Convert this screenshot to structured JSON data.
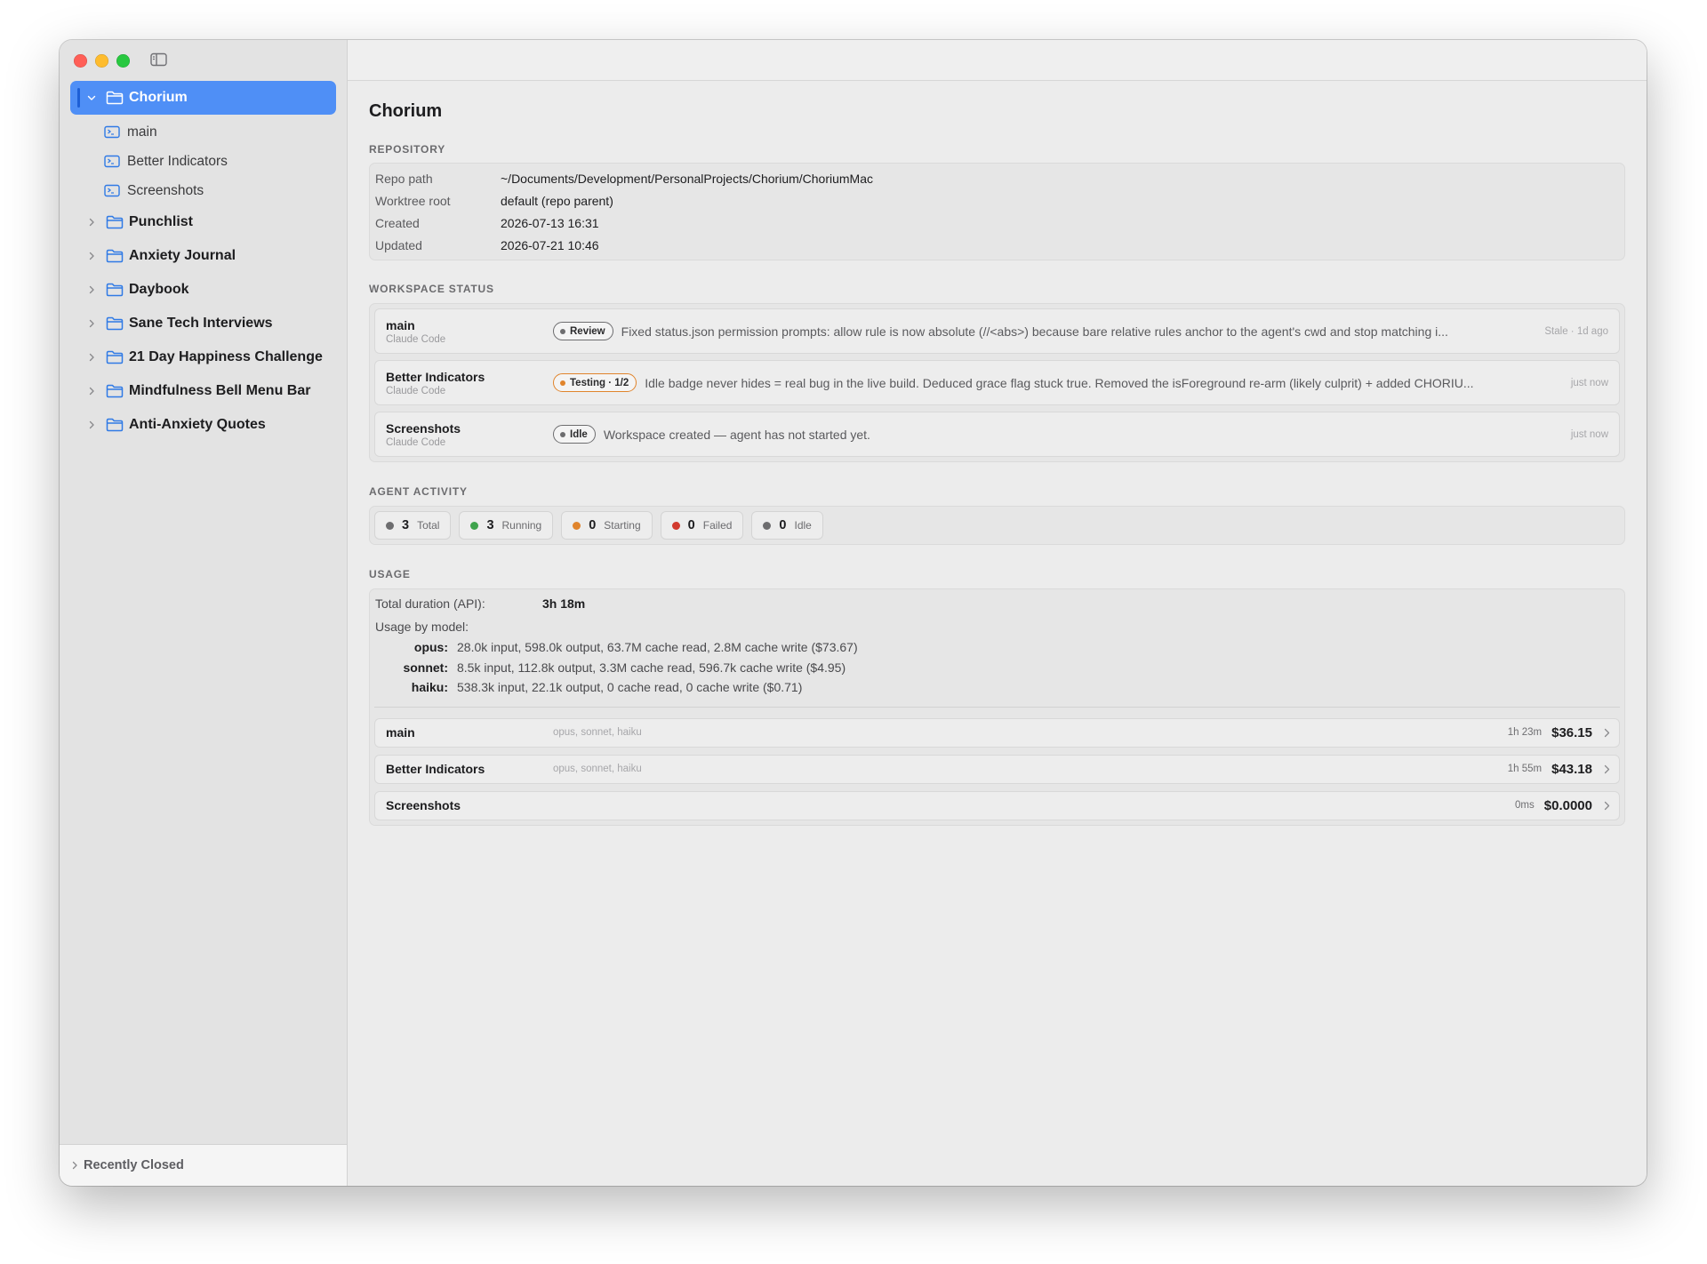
{
  "sidebar": {
    "projects": [
      {
        "label": "Chorium",
        "expanded": true,
        "selected": true,
        "branches": [
          {
            "label": "main"
          },
          {
            "label": "Better Indicators"
          },
          {
            "label": "Screenshots"
          }
        ]
      },
      {
        "label": "Punchlist"
      },
      {
        "label": "Anxiety Journal"
      },
      {
        "label": "Daybook"
      },
      {
        "label": "Sane Tech Interviews"
      },
      {
        "label": "21 Day Happiness Challenge"
      },
      {
        "label": "Mindfulness Bell Menu Bar"
      },
      {
        "label": "Anti-Anxiety Quotes"
      }
    ],
    "recently_closed": "Recently Closed"
  },
  "main": {
    "title": "Chorium",
    "repository": {
      "heading": "REPOSITORY",
      "rows": [
        {
          "key": "Repo path",
          "value": "~/Documents/Development/PersonalProjects/Chorium/ChoriumMac"
        },
        {
          "key": "Worktree root",
          "value": "default (repo parent)"
        },
        {
          "key": "Created",
          "value": "2026-07-13 16:31"
        },
        {
          "key": "Updated",
          "value": "2026-07-21 10:46"
        }
      ]
    },
    "workspace_status": {
      "heading": "WORKSPACE STATUS",
      "rows": [
        {
          "name": "main",
          "agent": "Claude Code",
          "badge": "Review",
          "badge_color": "#6d6d6f",
          "message": "Fixed status.json permission prompts: allow rule is now absolute (//<abs>) because bare relative rules anchor to the agent's cwd and stop matching i...",
          "time": "Stale · 1d ago"
        },
        {
          "name": "Better Indicators",
          "agent": "Claude Code",
          "badge": "Testing · 1/2",
          "badge_color": "#e0842c",
          "message": "Idle badge never hides = real bug in the live build. Deduced grace flag stuck true. Removed the isForeground re-arm (likely culprit) + added CHORIU...",
          "time": "just now"
        },
        {
          "name": "Screenshots",
          "agent": "Claude Code",
          "badge": "Idle",
          "badge_color": "#6d6d6f",
          "message": "Workspace created — agent has not started yet.",
          "time": "just now"
        }
      ]
    },
    "agent_activity": {
      "heading": "AGENT ACTIVITY",
      "pills": [
        {
          "count": "3",
          "label": "Total",
          "color": "#6d6d6f"
        },
        {
          "count": "3",
          "label": "Running",
          "color": "#3fa34d"
        },
        {
          "count": "0",
          "label": "Starting",
          "color": "#e0842c"
        },
        {
          "count": "0",
          "label": "Failed",
          "color": "#d23a2e"
        },
        {
          "count": "0",
          "label": "Idle",
          "color": "#6d6d6f"
        }
      ]
    },
    "usage": {
      "heading": "USAGE",
      "total_label": "Total duration (API):",
      "total_value": "3h 18m",
      "by_model_label": "Usage by model:",
      "models": [
        {
          "name": "opus:",
          "detail": "28.0k input, 598.0k output, 63.7M cache read, 2.8M cache write ($73.67)"
        },
        {
          "name": "sonnet:",
          "detail": "8.5k input, 112.8k output, 3.3M cache read, 596.7k cache write ($4.95)"
        },
        {
          "name": "haiku:",
          "detail": "538.3k input, 22.1k output, 0 cache read, 0 cache write ($0.71)"
        }
      ],
      "rows": [
        {
          "name": "main",
          "models": "opus, sonnet, haiku",
          "duration": "1h 23m",
          "cost": "$36.15"
        },
        {
          "name": "Better Indicators",
          "models": "opus, sonnet, haiku",
          "duration": "1h 55m",
          "cost": "$43.18"
        },
        {
          "name": "Screenshots",
          "models": "",
          "duration": "0ms",
          "cost": "$0.0000"
        }
      ]
    }
  },
  "colors": {
    "accent": "#4f8ff6",
    "folder_icon": "#2f7ae5"
  }
}
